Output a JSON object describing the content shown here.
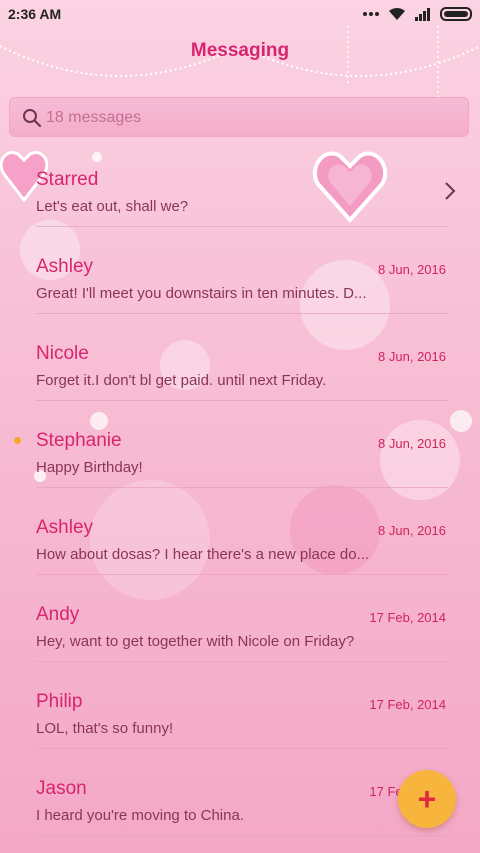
{
  "status": {
    "time": "2:36 AM"
  },
  "header": {
    "title": "Messaging"
  },
  "search": {
    "placeholder": "18 messages"
  },
  "colors": {
    "accent": "#d8256f",
    "fab": "#f8b53e",
    "unread_dot": "#f7a82a",
    "background": "#f8c3d8"
  },
  "conversations": [
    {
      "name": "Starred",
      "preview": "Let's eat out, shall we?",
      "date": ""
    },
    {
      "name": "Ashley",
      "preview": "Great! I'll meet you downstairs in ten minutes. D...",
      "date": "8 Jun, 2016"
    },
    {
      "name": "Nicole",
      "preview": "Forget it.I don't bl get paid. until next Friday.",
      "date": "8 Jun, 2016"
    },
    {
      "name": "Stephanie",
      "preview": "Happy Birthday!",
      "date": "8 Jun, 2016"
    },
    {
      "name": "Ashley",
      "preview": "How about dosas? I hear there's a new place do...",
      "date": "8 Jun, 2016"
    },
    {
      "name": "Andy",
      "preview": "Hey, want to get together with Nicole on Friday?",
      "date": "17 Feb, 2014"
    },
    {
      "name": "Philip",
      "preview": "LOL, that's so funny!",
      "date": "17 Feb, 2014"
    },
    {
      "name": "Jason",
      "preview": "I heard you're moving to China.",
      "date": "17 Feb, 2014"
    }
  ],
  "fab": {
    "label": "+"
  }
}
